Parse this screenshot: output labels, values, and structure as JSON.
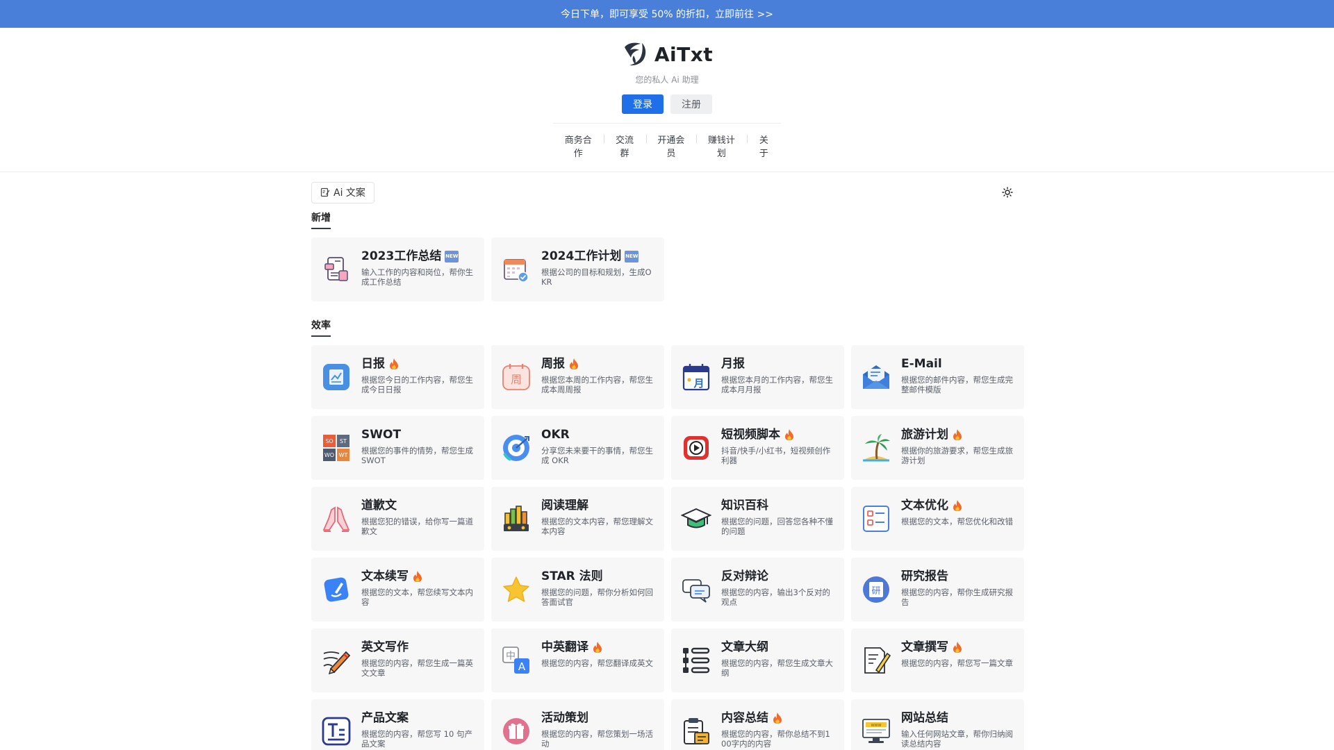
{
  "banner": {
    "text": "今日下单，即可享受 50% 的折扣，立即前往 >>"
  },
  "brand": {
    "name": "AiTxt",
    "slogan": "您的私人 Ai 助理"
  },
  "auth": {
    "login": "登录",
    "register": "注册"
  },
  "nav": [
    "商务合作",
    "交流群",
    "开通会员",
    "赚钱计划",
    "关于"
  ],
  "toolbar": {
    "tab_label": "Ai 文案",
    "tab_icon": "edit-doc-icon",
    "theme_icon": "sun-icon"
  },
  "sections": [
    {
      "title": "新增",
      "cards": [
        {
          "title": "2023工作总结",
          "desc": "输入工作的内容和岗位，帮你生成工作总结",
          "icon": "report-doc-icon",
          "badge": "new"
        },
        {
          "title": "2024工作计划",
          "desc": "根据公司的目标和规划，生成OKR",
          "icon": "calendar-check-icon",
          "badge": "new"
        }
      ]
    },
    {
      "title": "效率",
      "cards": [
        {
          "title": "日报",
          "desc": "根据您今日的工作内容，帮您生成今日日报",
          "icon": "daily-report-icon",
          "badge": "hot"
        },
        {
          "title": "周报",
          "desc": "根据您本周的工作内容，帮您生成本周周报",
          "icon": "weekly-report-icon",
          "badge": "hot"
        },
        {
          "title": "月报",
          "desc": "根据您本月的工作内容，帮您生成本月月报",
          "icon": "monthly-calendar-icon",
          "badge": ""
        },
        {
          "title": "E-Mail",
          "desc": "根据您的邮件内容，帮您生成完整邮件模版",
          "icon": "email-envelope-icon",
          "badge": ""
        },
        {
          "title": "SWOT",
          "desc": "根据您的事件的情势，帮您生成 SWOT",
          "icon": "swot-grid-icon",
          "badge": ""
        },
        {
          "title": "OKR",
          "desc": "分享您未来要干的事情，帮您生成 OKR",
          "icon": "target-icon",
          "badge": ""
        },
        {
          "title": "短视频脚本",
          "desc": "抖音/快手/小红书，短视频创作利器",
          "icon": "video-play-icon",
          "badge": "hot"
        },
        {
          "title": "旅游计划",
          "desc": "根据你的旅游要求，帮您生成旅游计划",
          "icon": "palm-island-icon",
          "badge": "hot"
        },
        {
          "title": "道歉文",
          "desc": "根据您犯的错误，给你写一篇道歉文",
          "icon": "pray-hands-icon",
          "badge": ""
        },
        {
          "title": "阅读理解",
          "desc": "根据您的文本内容，帮您理解文本内容",
          "icon": "bookshelf-icon",
          "badge": ""
        },
        {
          "title": "知识百科",
          "desc": "根据您的问题，回答您各种不懂的问题",
          "icon": "graduation-cap-icon",
          "badge": ""
        },
        {
          "title": "文本优化",
          "desc": "根据您的文本，帮您优化和改错",
          "icon": "list-document-icon",
          "badge": "hot"
        },
        {
          "title": "文本续写",
          "desc": "根据您的文本，帮您续写文本内容",
          "icon": "pen-cube-icon",
          "badge": "hot"
        },
        {
          "title": "STAR 法则",
          "desc": "根据您的问题，帮你分析如何回答面试官",
          "icon": "star-icon",
          "badge": ""
        },
        {
          "title": "反对辩论",
          "desc": "根据您的内容，输出3个反对的观点",
          "icon": "chat-bubbles-icon",
          "badge": ""
        },
        {
          "title": "研究报告",
          "desc": "根据您的内容，帮你生成研究报告",
          "icon": "research-badge-icon",
          "badge": ""
        },
        {
          "title": "英文写作",
          "desc": "根据您的内容，帮您生成一篇英文文章",
          "icon": "pencil-writing-icon",
          "badge": ""
        },
        {
          "title": "中英翻译",
          "desc": "根据您的内容，帮您翻译成英文",
          "icon": "translate-icon",
          "badge": "hot"
        },
        {
          "title": "文章大纲",
          "desc": "根据您的内容，帮您生成文章大纲",
          "icon": "outline-list-icon",
          "badge": ""
        },
        {
          "title": "文章撰写",
          "desc": "根据您的内容，帮您写一篇文章",
          "icon": "document-pen-icon",
          "badge": "hot"
        },
        {
          "title": "产品文案",
          "desc": "根据您的内容，帮您写 10 句产品文案",
          "icon": "text-frame-icon",
          "badge": ""
        },
        {
          "title": "活动策划",
          "desc": "根据您的内容，帮您策划一场活动",
          "icon": "gift-icon",
          "badge": ""
        },
        {
          "title": "内容总结",
          "desc": "根据您的内容，帮你总结不到100字内的内容",
          "icon": "clipboard-icon",
          "badge": "hot"
        },
        {
          "title": "网站总结",
          "desc": "输入任何网站文章，帮你归纳阅读总结内容",
          "icon": "monitor-web-icon",
          "badge": ""
        }
      ]
    }
  ]
}
